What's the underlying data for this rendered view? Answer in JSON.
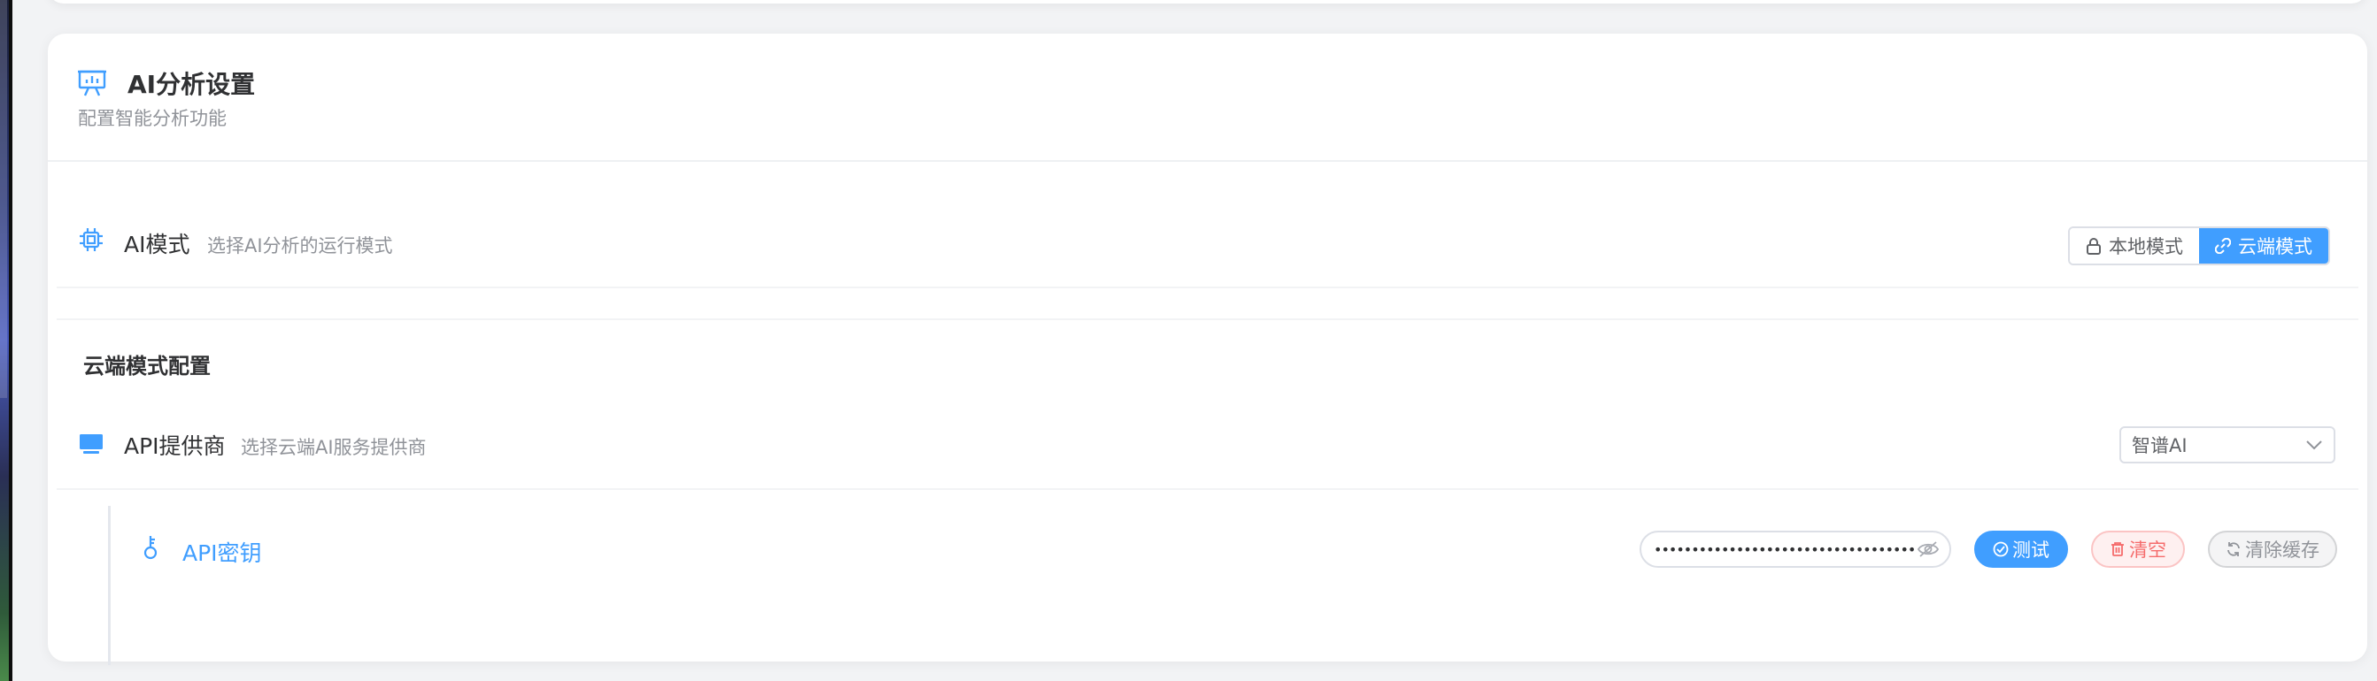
{
  "header": {
    "icon": "presentation-chart-icon",
    "title": "AI分析设置",
    "subtitle": "配置智能分析功能"
  },
  "ai_mode": {
    "icon": "cpu-chip-icon",
    "label": "AI模式",
    "description": "选择AI分析的运行模式",
    "options": [
      {
        "label": "本地模式",
        "icon": "lock-icon",
        "selected": false
      },
      {
        "label": "云端模式",
        "icon": "link-icon",
        "selected": true
      }
    ]
  },
  "cloud_config": {
    "section_title": "云端模式配置",
    "provider": {
      "icon": "monitor-icon",
      "label": "API提供商",
      "description": "选择云端AI服务提供商",
      "selected": "智谱AI"
    },
    "api_key": {
      "icon": "key-icon",
      "label": "API密钥",
      "masked_value": "••••••••••••••••••••••••••••••••••••••••••••"
    },
    "buttons": {
      "test": "测试",
      "clear": "清空",
      "clear_cache": "清除缓存"
    }
  },
  "colors": {
    "accent": "#409eff",
    "danger": "#f56c6c",
    "muted": "#909399"
  }
}
